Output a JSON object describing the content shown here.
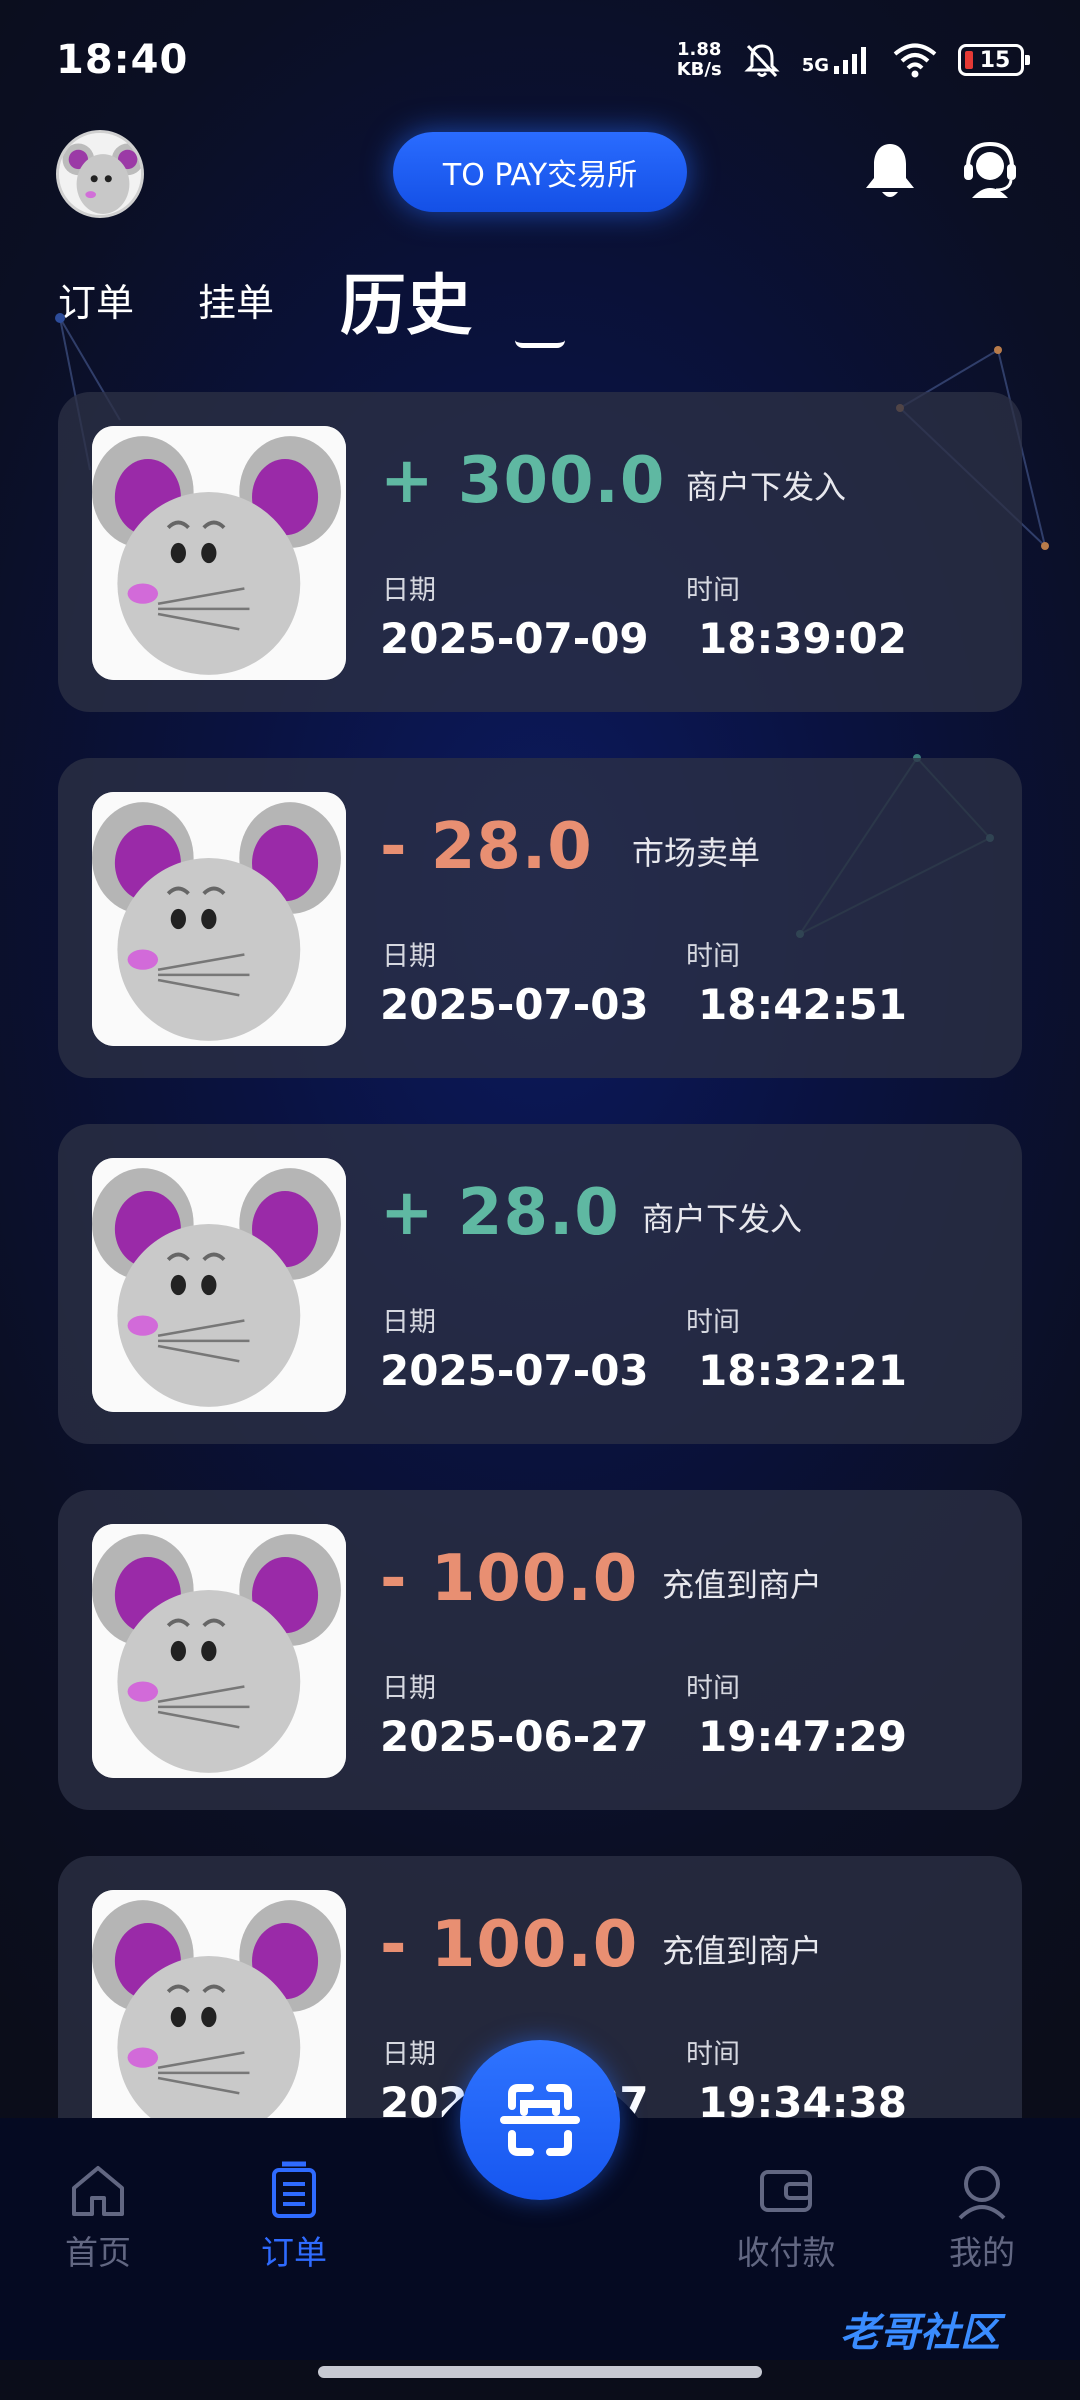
{
  "status_bar": {
    "time": "18:40",
    "net_speed_value": "1.88",
    "net_speed_unit": "KB/s",
    "network_type": "5G",
    "battery_level": "15",
    "icons": [
      "mute-bell-icon",
      "signal-icon",
      "wifi-icon",
      "battery-icon"
    ]
  },
  "header": {
    "brand": "TO PAY交易所",
    "accent_color": "#1f5fff"
  },
  "tabs": [
    {
      "label": "订单",
      "active": false
    },
    {
      "label": "挂单",
      "active": false
    },
    {
      "label": "历史",
      "active": true
    }
  ],
  "records": [
    {
      "amount": "+ 300.0",
      "type": "商户下发入",
      "date_label": "日期",
      "date": "2025-07-09",
      "time_label": "时间",
      "time": "18:39:02",
      "sign": "positive"
    },
    {
      "amount": "- 28.0",
      "type": "市场卖单",
      "date_label": "日期",
      "date": "2025-07-03",
      "time_label": "时间",
      "time": "18:42:51",
      "sign": "negative"
    },
    {
      "amount": "+ 28.0",
      "type": "商户下发入",
      "date_label": "日期",
      "date": "2025-07-03",
      "time_label": "时间",
      "time": "18:32:21",
      "sign": "positive"
    },
    {
      "amount": "- 100.0",
      "type": "充值到商户",
      "date_label": "日期",
      "date": "2025-06-27",
      "time_label": "时间",
      "time": "19:47:29",
      "sign": "negative"
    },
    {
      "amount": "- 100.0",
      "type": "充值到商户",
      "date_label": "日期",
      "date": "2025-06-27",
      "time_label": "时间",
      "time": "19:34:38",
      "sign": "negative"
    }
  ],
  "colors": {
    "positive": "#5fb8a2",
    "negative": "#e88f72",
    "nav_active": "#2f6bff",
    "nav_inactive": "#626782"
  },
  "bottom_nav": [
    {
      "label": "首页",
      "icon": "home-icon",
      "active": false
    },
    {
      "label": "订单",
      "icon": "orders-icon",
      "active": true
    },
    {
      "label": "收付款",
      "icon": "wallet-icon",
      "active": false
    },
    {
      "label": "我的",
      "icon": "profile-icon",
      "active": false
    }
  ],
  "scan_button": {
    "icon": "scan-icon"
  },
  "watermark": "老哥社区"
}
